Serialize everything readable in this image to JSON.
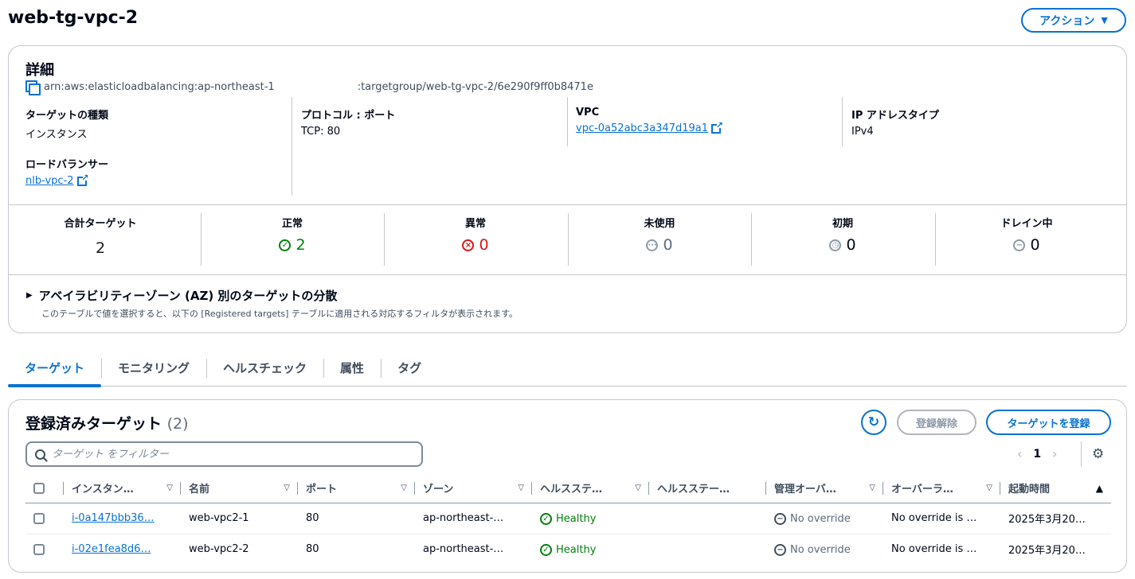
{
  "page": {
    "title": "web-tg-vpc-2",
    "actions_label": "アクション"
  },
  "details": {
    "heading": "詳細",
    "arn_prefix": "arn:aws:elasticloadbalancing:ap-northeast-1",
    "arn_suffix": ":targetgroup/web-tg-vpc-2/6e290f9ff0b8471e",
    "target_type_label": "ターゲットの種類",
    "target_type_value": "インスタンス",
    "protocol_label": "プロトコル : ポート",
    "protocol_value": "TCP: 80",
    "vpc_label": "VPC",
    "vpc_value": "vpc-0a52abc3a347d19a1",
    "ip_type_label": "IP アドレスタイプ",
    "ip_type_value": "IPv4",
    "lb_label": "ロードバランサー",
    "lb_value": "nlb-vpc-2"
  },
  "stats": [
    {
      "label": "合計ターゲット",
      "value": "2",
      "status": "none"
    },
    {
      "label": "正常",
      "value": "2",
      "status": "healthy"
    },
    {
      "label": "異常",
      "value": "0",
      "status": "unhealthy"
    },
    {
      "label": "未使用",
      "value": "0",
      "status": "unused"
    },
    {
      "label": "初期",
      "value": "0",
      "status": "initial"
    },
    {
      "label": "ドレイン中",
      "value": "0",
      "status": "draining"
    }
  ],
  "az": {
    "title": "アベイラビリティーゾーン (AZ) 別のターゲットの分散",
    "description": "このテーブルで値を選択すると、以下の [Registered targets] テーブルに適用される対応するフィルタが表示されます。"
  },
  "tabs": [
    {
      "label": "ターゲット",
      "active": true
    },
    {
      "label": "モニタリング",
      "active": false
    },
    {
      "label": "ヘルスチェック",
      "active": false
    },
    {
      "label": "属性",
      "active": false
    },
    {
      "label": "タグ",
      "active": false
    }
  ],
  "targets": {
    "title": "登録済みターゲット",
    "count": "(2)",
    "deregister_label": "登録解除",
    "register_label": "ターゲットを登録",
    "filter_placeholder": "ターゲット をフィルター",
    "page_number": "1",
    "columns": [
      "インスタン…",
      "名前",
      "ポート",
      "ゾーン",
      "ヘルスステ…",
      "ヘルスステー…",
      "管理オーバ…",
      "オーバーラ…",
      "起動時間"
    ],
    "rows": [
      {
        "instance": "i-0a147bbb36…",
        "name": "web-vpc2-1",
        "port": "80",
        "zone": "ap-northeast-…",
        "health": "Healthy",
        "health_detail": "",
        "admin_override": "No override",
        "override_reason": "No override is …",
        "launch_time": "2025年3月20…"
      },
      {
        "instance": "i-02e1fea8d6…",
        "name": "web-vpc2-2",
        "port": "80",
        "zone": "ap-northeast-…",
        "health": "Healthy",
        "health_detail": "",
        "admin_override": "No override",
        "override_reason": "No override is …",
        "launch_time": "2025年3月20…"
      }
    ]
  },
  "colors": {
    "accent": "#0972d3",
    "success": "#037f0c",
    "error": "#d91515",
    "muted": "#8d99a8"
  },
  "icons": {
    "copy": "copy-icon",
    "external": "external-link-icon",
    "refresh": "refresh-icon",
    "search": "search-icon",
    "settings": "gear-icon"
  }
}
